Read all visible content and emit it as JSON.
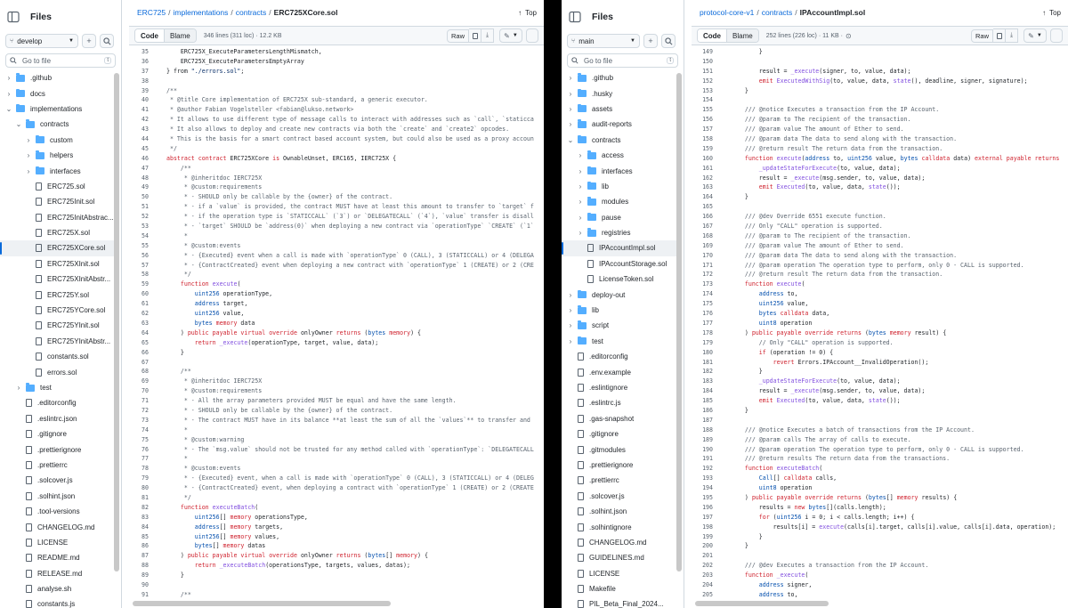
{
  "left": {
    "sidebar": {
      "title": "Files",
      "branch": "develop",
      "goto_placeholder": "Go to file",
      "goto_key": "t",
      "tree": [
        {
          "label": ".github",
          "kind": "folder",
          "depth": 0,
          "open": false
        },
        {
          "label": "docs",
          "kind": "folder",
          "depth": 0,
          "open": false
        },
        {
          "label": "implementations",
          "kind": "folder",
          "depth": 0,
          "open": true
        },
        {
          "label": "contracts",
          "kind": "folder",
          "depth": 1,
          "open": true
        },
        {
          "label": "custom",
          "kind": "folder",
          "depth": 2,
          "open": false
        },
        {
          "label": "helpers",
          "kind": "folder",
          "depth": 2,
          "open": false
        },
        {
          "label": "interfaces",
          "kind": "folder",
          "depth": 2,
          "open": false
        },
        {
          "label": "ERC725.sol",
          "kind": "file",
          "depth": 2
        },
        {
          "label": "ERC725Init.sol",
          "kind": "file",
          "depth": 2
        },
        {
          "label": "ERC725InitAbstrac...",
          "kind": "file",
          "depth": 2
        },
        {
          "label": "ERC725X.sol",
          "kind": "file",
          "depth": 2
        },
        {
          "label": "ERC725XCore.sol",
          "kind": "file",
          "depth": 2,
          "selected": true
        },
        {
          "label": "ERC725XInit.sol",
          "kind": "file",
          "depth": 2
        },
        {
          "label": "ERC725XInitAbstr...",
          "kind": "file",
          "depth": 2
        },
        {
          "label": "ERC725Y.sol",
          "kind": "file",
          "depth": 2
        },
        {
          "label": "ERC725YCore.sol",
          "kind": "file",
          "depth": 2
        },
        {
          "label": "ERC725YInit.sol",
          "kind": "file",
          "depth": 2
        },
        {
          "label": "ERC725YInitAbstr...",
          "kind": "file",
          "depth": 2
        },
        {
          "label": "constants.sol",
          "kind": "file",
          "depth": 2
        },
        {
          "label": "errors.sol",
          "kind": "file",
          "depth": 2
        },
        {
          "label": "test",
          "kind": "folder",
          "depth": 1,
          "open": false
        },
        {
          "label": ".editorconfig",
          "kind": "file",
          "depth": 1
        },
        {
          "label": ".eslintrc.json",
          "kind": "file",
          "depth": 1
        },
        {
          "label": ".gitignore",
          "kind": "file",
          "depth": 1
        },
        {
          "label": ".prettierignore",
          "kind": "file",
          "depth": 1
        },
        {
          "label": ".prettierrc",
          "kind": "file",
          "depth": 1
        },
        {
          "label": ".solcover.js",
          "kind": "file",
          "depth": 1
        },
        {
          "label": ".solhint.json",
          "kind": "file",
          "depth": 1
        },
        {
          "label": ".tool-versions",
          "kind": "file",
          "depth": 1
        },
        {
          "label": "CHANGELOG.md",
          "kind": "file",
          "depth": 1
        },
        {
          "label": "LICENSE",
          "kind": "file",
          "depth": 1
        },
        {
          "label": "README.md",
          "kind": "file",
          "depth": 1
        },
        {
          "label": "RELEASE.md",
          "kind": "file",
          "depth": 1
        },
        {
          "label": "analyse.sh",
          "kind": "file",
          "depth": 1
        },
        {
          "label": "constants.js",
          "kind": "file",
          "depth": 1
        }
      ]
    },
    "breadcrumb": {
      "repo": "ERC725",
      "parts": [
        "implementations",
        "contracts"
      ],
      "file": "ERC725XCore.sol"
    },
    "top_label": "Top",
    "tabs": {
      "code": "Code",
      "blame": "Blame"
    },
    "meta": "346 lines (311 loc) · 12.2 KB",
    "raw_label": "Raw",
    "lines": [
      {
        "n": "35",
        "t": "    ERC725X_ExecuteParametersLengthMismatch,"
      },
      {
        "n": "36",
        "t": "    ERC725X_ExecuteParametersEmptyArray"
      },
      {
        "n": "37",
        "t": "} from \"./errors.sol\";"
      },
      {
        "n": "38",
        "t": ""
      },
      {
        "n": "39",
        "t": "/**"
      },
      {
        "n": "40",
        "t": " * @title Core implementation of ERC725X sub-standard, a generic executor."
      },
      {
        "n": "41",
        "t": " * @author Fabian Vogelsteller <fabian@lukso.network>"
      },
      {
        "n": "42",
        "t": " * It allows to use different type of message calls to interact with addresses such as `call`, `staticca"
      },
      {
        "n": "43",
        "t": " * It also allows to deploy and create new contracts via both the `create` and `create2` opcodes."
      },
      {
        "n": "44",
        "t": " * This is the basis for a smart contract based account system, but could also be used as a proxy accoun"
      },
      {
        "n": "45",
        "t": " */"
      },
      {
        "n": "46",
        "t": "abstract contract ERC725XCore is OwnableUnset, ERC165, IERC725X {"
      },
      {
        "n": "47",
        "t": "    /**"
      },
      {
        "n": "48",
        "t": "     * @inheritdoc IERC725X"
      },
      {
        "n": "49",
        "t": "     * @custom:requirements"
      },
      {
        "n": "50",
        "t": "     * - SHOULD only be callable by the {owner} of the contract."
      },
      {
        "n": "51",
        "t": "     * - if a `value` is provided, the contract MUST have at least this amount to transfer to `target` f"
      },
      {
        "n": "52",
        "t": "     * - if the operation type is `STATICCALL` (`3`) or `DELEGATECALL` (`4`), `value` transfer is disall"
      },
      {
        "n": "53",
        "t": "     * - `target` SHOULD be `address(0)` when deploying a new contract via `operationType` `CREATE` (`1`"
      },
      {
        "n": "54",
        "t": "     *"
      },
      {
        "n": "55",
        "t": "     * @custom:events"
      },
      {
        "n": "56",
        "t": "     * - {Executed} event when a call is made with `operationType` 0 (CALL), 3 (STATICCALL) or 4 (DELEGA"
      },
      {
        "n": "57",
        "t": "     * - {ContractCreated} event when deploying a new contract with `operationType` 1 (CREATE) or 2 (CRE"
      },
      {
        "n": "58",
        "t": "     */"
      },
      {
        "n": "59",
        "t": "    function execute("
      },
      {
        "n": "60",
        "t": "        uint256 operationType,"
      },
      {
        "n": "61",
        "t": "        address target,"
      },
      {
        "n": "62",
        "t": "        uint256 value,"
      },
      {
        "n": "63",
        "t": "        bytes memory data"
      },
      {
        "n": "64",
        "t": "    ) public payable virtual override onlyOwner returns (bytes memory) {"
      },
      {
        "n": "65",
        "t": "        return _execute(operationType, target, value, data);"
      },
      {
        "n": "66",
        "t": "    }"
      },
      {
        "n": "67",
        "t": ""
      },
      {
        "n": "68",
        "t": "    /**"
      },
      {
        "n": "69",
        "t": "     * @inheritdoc IERC725X"
      },
      {
        "n": "70",
        "t": "     * @custom:requirements"
      },
      {
        "n": "71",
        "t": "     * - All the array parameters provided MUST be equal and have the same length."
      },
      {
        "n": "72",
        "t": "     * - SHOULD only be callable by the {owner} of the contract."
      },
      {
        "n": "73",
        "t": "     * - The contract MUST have in its balance **at least the sum of all the `values`** to transfer and"
      },
      {
        "n": "74",
        "t": "     *"
      },
      {
        "n": "75",
        "t": "     * @custom:warning"
      },
      {
        "n": "76",
        "t": "     * - The `msg.value` should not be trusted for any method called with `operationType`: `DELEGATECALL"
      },
      {
        "n": "77",
        "t": "     *"
      },
      {
        "n": "78",
        "t": "     * @custom:events"
      },
      {
        "n": "79",
        "t": "     * - {Executed} event, when a call is made with `operationType` 0 (CALL), 3 (STATICCALL) or 4 (DELEG"
      },
      {
        "n": "80",
        "t": "     * - {ContractCreated} event, when deploying a contract with `operationType` 1 (CREATE) or 2 (CREATE"
      },
      {
        "n": "81",
        "t": "     */"
      },
      {
        "n": "82",
        "t": "    function executeBatch("
      },
      {
        "n": "83",
        "t": "        uint256[] memory operationsType,"
      },
      {
        "n": "84",
        "t": "        address[] memory targets,"
      },
      {
        "n": "85",
        "t": "        uint256[] memory values,"
      },
      {
        "n": "86",
        "t": "        bytes[] memory datas"
      },
      {
        "n": "87",
        "t": "    ) public payable virtual override onlyOwner returns (bytes[] memory) {"
      },
      {
        "n": "88",
        "t": "        return _executeBatch(operationsType, targets, values, datas);"
      },
      {
        "n": "89",
        "t": "    }"
      },
      {
        "n": "90",
        "t": ""
      },
      {
        "n": "91",
        "t": "    /**"
      }
    ]
  },
  "right": {
    "sidebar": {
      "title": "Files",
      "branch": "main",
      "goto_placeholder": "Go to file",
      "goto_key": "t",
      "tree": [
        {
          "label": ".github",
          "kind": "folder",
          "depth": 0,
          "open": false
        },
        {
          "label": ".husky",
          "kind": "folder",
          "depth": 0,
          "open": false
        },
        {
          "label": "assets",
          "kind": "folder",
          "depth": 0,
          "open": false
        },
        {
          "label": "audit-reports",
          "kind": "folder",
          "depth": 0,
          "open": false
        },
        {
          "label": "contracts",
          "kind": "folder",
          "depth": 0,
          "open": true
        },
        {
          "label": "access",
          "kind": "folder",
          "depth": 1,
          "open": false
        },
        {
          "label": "interfaces",
          "kind": "folder",
          "depth": 1,
          "open": false
        },
        {
          "label": "lib",
          "kind": "folder",
          "depth": 1,
          "open": false
        },
        {
          "label": "modules",
          "kind": "folder",
          "depth": 1,
          "open": false
        },
        {
          "label": "pause",
          "kind": "folder",
          "depth": 1,
          "open": false
        },
        {
          "label": "registries",
          "kind": "folder",
          "depth": 1,
          "open": false
        },
        {
          "label": "IPAccountImpl.sol",
          "kind": "file",
          "depth": 1,
          "selected": true
        },
        {
          "label": "IPAccountStorage.sol",
          "kind": "file",
          "depth": 1
        },
        {
          "label": "LicenseToken.sol",
          "kind": "file",
          "depth": 1
        },
        {
          "label": "deploy-out",
          "kind": "folder",
          "depth": 0,
          "open": false
        },
        {
          "label": "lib",
          "kind": "folder",
          "depth": 0,
          "open": false
        },
        {
          "label": "script",
          "kind": "folder",
          "depth": 0,
          "open": false
        },
        {
          "label": "test",
          "kind": "folder",
          "depth": 0,
          "open": false
        },
        {
          "label": ".editorconfig",
          "kind": "file",
          "depth": 0
        },
        {
          "label": ".env.example",
          "kind": "file",
          "depth": 0
        },
        {
          "label": ".eslintignore",
          "kind": "file",
          "depth": 0
        },
        {
          "label": ".eslintrc.js",
          "kind": "file",
          "depth": 0
        },
        {
          "label": ".gas-snapshot",
          "kind": "file",
          "depth": 0
        },
        {
          "label": ".gitignore",
          "kind": "file",
          "depth": 0
        },
        {
          "label": ".gitmodules",
          "kind": "file",
          "depth": 0
        },
        {
          "label": ".prettierignore",
          "kind": "file",
          "depth": 0
        },
        {
          "label": ".prettierrc",
          "kind": "file",
          "depth": 0
        },
        {
          "label": ".solcover.js",
          "kind": "file",
          "depth": 0
        },
        {
          "label": ".solhint.json",
          "kind": "file",
          "depth": 0
        },
        {
          "label": ".solhintignore",
          "kind": "file",
          "depth": 0
        },
        {
          "label": "CHANGELOG.md",
          "kind": "file",
          "depth": 0
        },
        {
          "label": "GUIDELINES.md",
          "kind": "file",
          "depth": 0
        },
        {
          "label": "LICENSE",
          "kind": "file",
          "depth": 0
        },
        {
          "label": "Makefile",
          "kind": "file",
          "depth": 0
        },
        {
          "label": "PIL_Beta_Final_2024...",
          "kind": "file",
          "depth": 0
        }
      ]
    },
    "breadcrumb": {
      "repo": "protocol-core-v1",
      "parts": [
        "contracts"
      ],
      "file": "IPAccountImpl.sol"
    },
    "top_label": "Top",
    "tabs": {
      "code": "Code",
      "blame": "Blame"
    },
    "meta": "252 lines (226 loc) · 11 KB ·",
    "raw_label": "Raw",
    "lines": [
      {
        "n": "149",
        "t": "        }"
      },
      {
        "n": "150",
        "t": ""
      },
      {
        "n": "151",
        "t": "        result = _execute(signer, to, value, data);"
      },
      {
        "n": "152",
        "t": "        emit ExecutedWithSig(to, value, data, state(), deadline, signer, signature);"
      },
      {
        "n": "153",
        "t": "    }"
      },
      {
        "n": "154",
        "t": ""
      },
      {
        "n": "155",
        "t": "    /// @notice Executes a transaction from the IP Account."
      },
      {
        "n": "156",
        "t": "    /// @param to The recipient of the transaction."
      },
      {
        "n": "157",
        "t": "    /// @param value The amount of Ether to send."
      },
      {
        "n": "158",
        "t": "    /// @param data The data to send along with the transaction."
      },
      {
        "n": "159",
        "t": "    /// @return result The return data from the transaction."
      },
      {
        "n": "160",
        "t": "    function execute(address to, uint256 value, bytes calldata data) external payable returns"
      },
      {
        "n": "161",
        "t": "        _updateStateForExecute(to, value, data);"
      },
      {
        "n": "162",
        "t": "        result = _execute(msg.sender, to, value, data);"
      },
      {
        "n": "163",
        "t": "        emit Executed(to, value, data, state());"
      },
      {
        "n": "164",
        "t": "    }"
      },
      {
        "n": "165",
        "t": ""
      },
      {
        "n": "166",
        "t": "    /// @dev Override 6551 execute function."
      },
      {
        "n": "167",
        "t": "    /// Only \"CALL\" operation is supported."
      },
      {
        "n": "168",
        "t": "    /// @param to The recipient of the transaction."
      },
      {
        "n": "169",
        "t": "    /// @param value The amount of Ether to send."
      },
      {
        "n": "170",
        "t": "    /// @param data The data to send along with the transaction."
      },
      {
        "n": "171",
        "t": "    /// @param operation The operation type to perform, only 0 - CALL is supported."
      },
      {
        "n": "172",
        "t": "    /// @return result The return data from the transaction."
      },
      {
        "n": "173",
        "t": "    function execute("
      },
      {
        "n": "174",
        "t": "        address to,"
      },
      {
        "n": "175",
        "t": "        uint256 value,"
      },
      {
        "n": "176",
        "t": "        bytes calldata data,"
      },
      {
        "n": "177",
        "t": "        uint8 operation"
      },
      {
        "n": "178",
        "t": "    ) public payable override returns (bytes memory result) {"
      },
      {
        "n": "179",
        "t": "        // Only \"CALL\" operation is supported."
      },
      {
        "n": "180",
        "t": "        if (operation != 0) {"
      },
      {
        "n": "181",
        "t": "            revert Errors.IPAccount__InvalidOperation();"
      },
      {
        "n": "182",
        "t": "        }"
      },
      {
        "n": "183",
        "t": "        _updateStateForExecute(to, value, data);"
      },
      {
        "n": "184",
        "t": "        result = _execute(msg.sender, to, value, data);"
      },
      {
        "n": "185",
        "t": "        emit Executed(to, value, data, state());"
      },
      {
        "n": "186",
        "t": "    }"
      },
      {
        "n": "187",
        "t": ""
      },
      {
        "n": "188",
        "t": "    /// @notice Executes a batch of transactions from the IP Account."
      },
      {
        "n": "189",
        "t": "    /// @param calls The array of calls to execute."
      },
      {
        "n": "190",
        "t": "    /// @param operation The operation type to perform, only 0 - CALL is supported."
      },
      {
        "n": "191",
        "t": "    /// @return results The return data from the transactions."
      },
      {
        "n": "192",
        "t": "    function executeBatch("
      },
      {
        "n": "193",
        "t": "        Call[] calldata calls,"
      },
      {
        "n": "194",
        "t": "        uint8 operation"
      },
      {
        "n": "195",
        "t": "    ) public payable override returns (bytes[] memory results) {"
      },
      {
        "n": "196",
        "t": "        results = new bytes[](calls.length);"
      },
      {
        "n": "197",
        "t": "        for (uint256 i = 0; i < calls.length; i++) {"
      },
      {
        "n": "198",
        "t": "            results[i] = execute(calls[i].target, calls[i].value, calls[i].data, operation);"
      },
      {
        "n": "199",
        "t": "        }"
      },
      {
        "n": "200",
        "t": "    }"
      },
      {
        "n": "201",
        "t": ""
      },
      {
        "n": "202",
        "t": "    /// @dev Executes a transaction from the IP Account."
      },
      {
        "n": "203",
        "t": "    function _execute("
      },
      {
        "n": "204",
        "t": "        address signer,"
      },
      {
        "n": "205",
        "t": "        address to,"
      }
    ]
  },
  "colors": {
    "link": "#0969da",
    "folder": "#54aeff",
    "border": "#d1d9e0",
    "keyword": "#cf222e",
    "entity": "#8250df",
    "comment": "#59636e"
  }
}
